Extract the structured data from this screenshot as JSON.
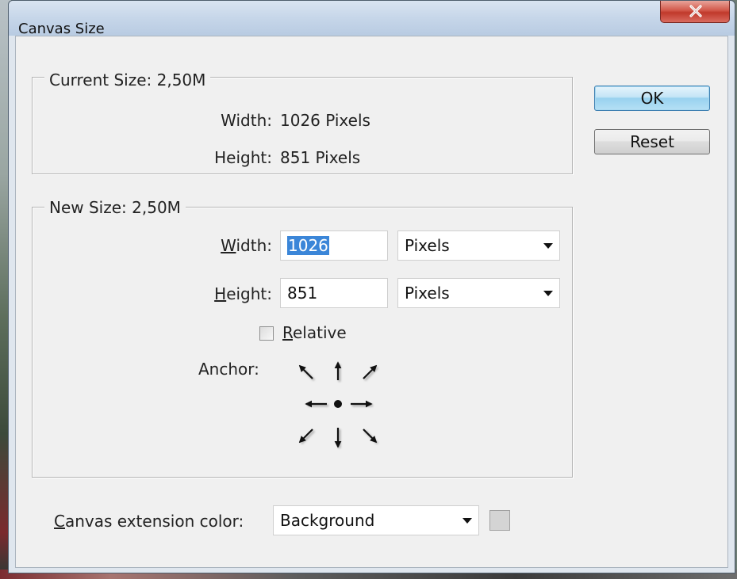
{
  "window": {
    "title": "Canvas Size"
  },
  "current_size": {
    "legend": "Current Size: 2,50M",
    "width_label": "Width:",
    "width_value": "1026 Pixels",
    "height_label": "Height:",
    "height_value": "851 Pixels"
  },
  "new_size": {
    "legend": "New Size: 2,50M",
    "width_label_accel": "W",
    "width_label_rest": "idth:",
    "width_value": "1026",
    "width_unit": "Pixels",
    "height_label_accel": "H",
    "height_label_rest": "eight:",
    "height_value": "851",
    "height_unit": "Pixels",
    "relative_accel": "R",
    "relative_rest": "elative",
    "relative_checked": false,
    "anchor_label": "Anchor:",
    "anchor_selected": "center"
  },
  "extension": {
    "label_accel": "C",
    "label_rest": "anvas extension color:",
    "value": "Background",
    "swatch_color": "#d4d4d4"
  },
  "buttons": {
    "ok": "OK",
    "reset": "Reset"
  },
  "icons": {
    "close": "close-icon",
    "dropdown": "chevron-down-icon",
    "anchor_arrows": [
      "arrow-up-left-icon",
      "arrow-up-icon",
      "arrow-up-right-icon",
      "arrow-left-icon",
      "anchor-dot-icon",
      "arrow-right-icon",
      "arrow-down-left-icon",
      "arrow-down-icon",
      "arrow-down-right-icon"
    ]
  },
  "colors": {
    "selection": "#3b86d8",
    "close_button": "#c0392b",
    "default_button": "#98d1ef"
  }
}
